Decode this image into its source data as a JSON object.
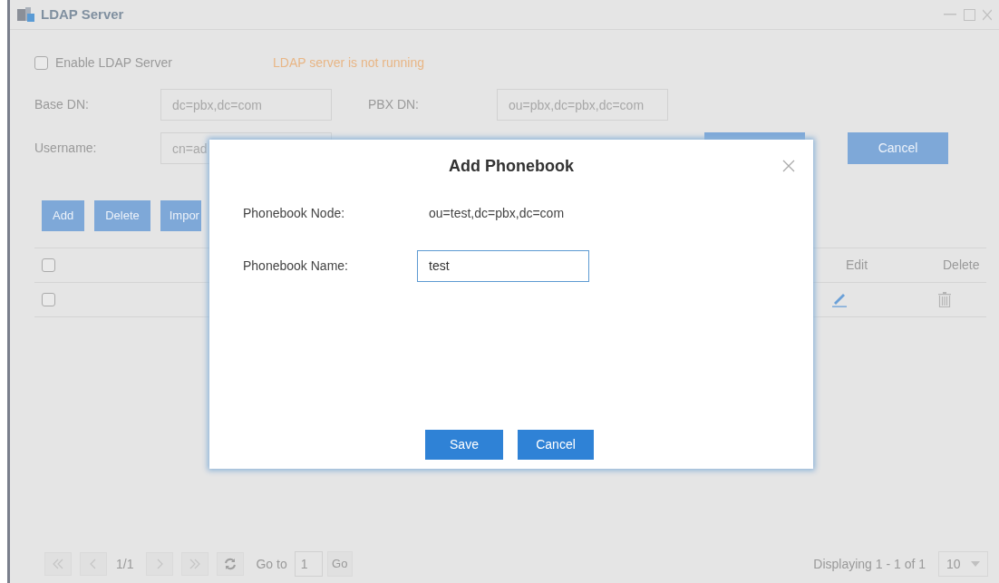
{
  "window": {
    "title": "LDAP Server"
  },
  "enable": {
    "label": "Enable LDAP Server",
    "checked": false
  },
  "server_status": "LDAP server is not running",
  "fields": [
    {
      "label": "Base DN:",
      "value": "dc=pbx,dc=com"
    },
    {
      "label": "PBX DN:",
      "value": "ou=pbx,dc=pbx,dc=com"
    },
    {
      "label": "Username:",
      "value": "cn=ad"
    }
  ],
  "form_buttons": [
    "Cancel"
  ],
  "toolbar": [
    "Add",
    "Delete",
    "Impor"
  ],
  "table": {
    "select_all": {
      "checked": false
    },
    "columns": [
      "Edit",
      "Delete"
    ],
    "rows": [
      {
        "checked": false
      }
    ]
  },
  "pagination": {
    "page": "1/1",
    "goto_label": "Go to",
    "goto_value": "1",
    "go": "Go",
    "summary": "Displaying 1 - 1 of 1",
    "page_size": "10"
  },
  "dialog": {
    "title": "Add Phonebook",
    "node_label": "Phonebook Node:",
    "node_value": "ou=test,dc=pbx,dc=com",
    "name_label": "Phonebook Name:",
    "name_value": "test",
    "buttons": [
      "Save",
      "Cancel"
    ]
  }
}
